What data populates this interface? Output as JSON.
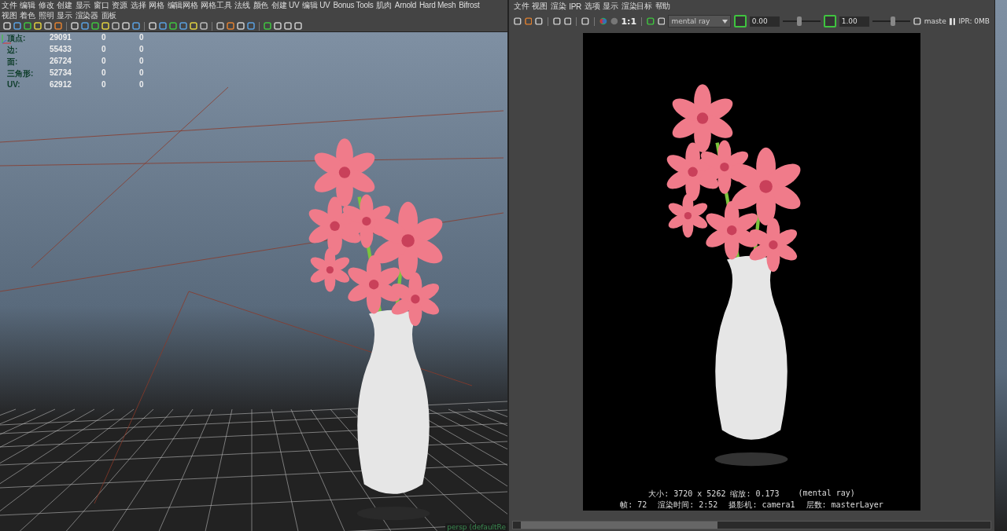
{
  "main_menu": [
    "文件",
    "编辑",
    "修改",
    "创建",
    "显示",
    "窗口",
    "资源",
    "选择",
    "网格",
    "编辑网格",
    "网格工具",
    "法线",
    "颜色",
    "创建 UV",
    "编辑 UV",
    "Bonus Tools",
    "肌肉",
    "Arnold",
    "Hard Mesh",
    "Bifrost"
  ],
  "panel_menu": [
    "视图",
    "着色",
    "照明",
    "显示",
    "渲染器",
    "面板"
  ],
  "hud_stats": [
    {
      "label": "顶点:",
      "value": "29091",
      "col_2": "0",
      "col_3": "0"
    },
    {
      "label": "边:",
      "value": "55433",
      "col_2": "0",
      "col_3": "0"
    },
    {
      "label": "面:",
      "value": "26724",
      "col_2": "0",
      "col_3": "0"
    },
    {
      "label": "三角形:",
      "value": "52734",
      "col_2": "0",
      "col_3": "0"
    },
    {
      "label": "UV:",
      "value": "62912",
      "col_2": "0",
      "col_3": "0"
    }
  ],
  "camera_label": "persp (defaultRe",
  "render_view": {
    "menu": [
      "文件",
      "视图",
      "渲染",
      "IPR",
      "选项",
      "显示",
      "渲染目标",
      "帮助"
    ],
    "ratio_label": "1:1",
    "renderer": "mental ray",
    "exposure": {
      "value": "0.00",
      "level": 0.45
    },
    "gamma": {
      "value": "1.00",
      "level": 0.55
    },
    "layer": "maste",
    "ipr": "IPR: 0MB",
    "info_line_1": [
      {
        "text": "大小: 3720 x 5262 缩放: 0.173"
      },
      {
        "text": "(mental ray)"
      }
    ],
    "info_line_2": [
      {
        "text": "帧: 72"
      },
      {
        "text": "渲染时间: 2:52"
      },
      {
        "text": "摄影机: camera1"
      },
      {
        "text": "层数: masterLayer"
      }
    ]
  }
}
